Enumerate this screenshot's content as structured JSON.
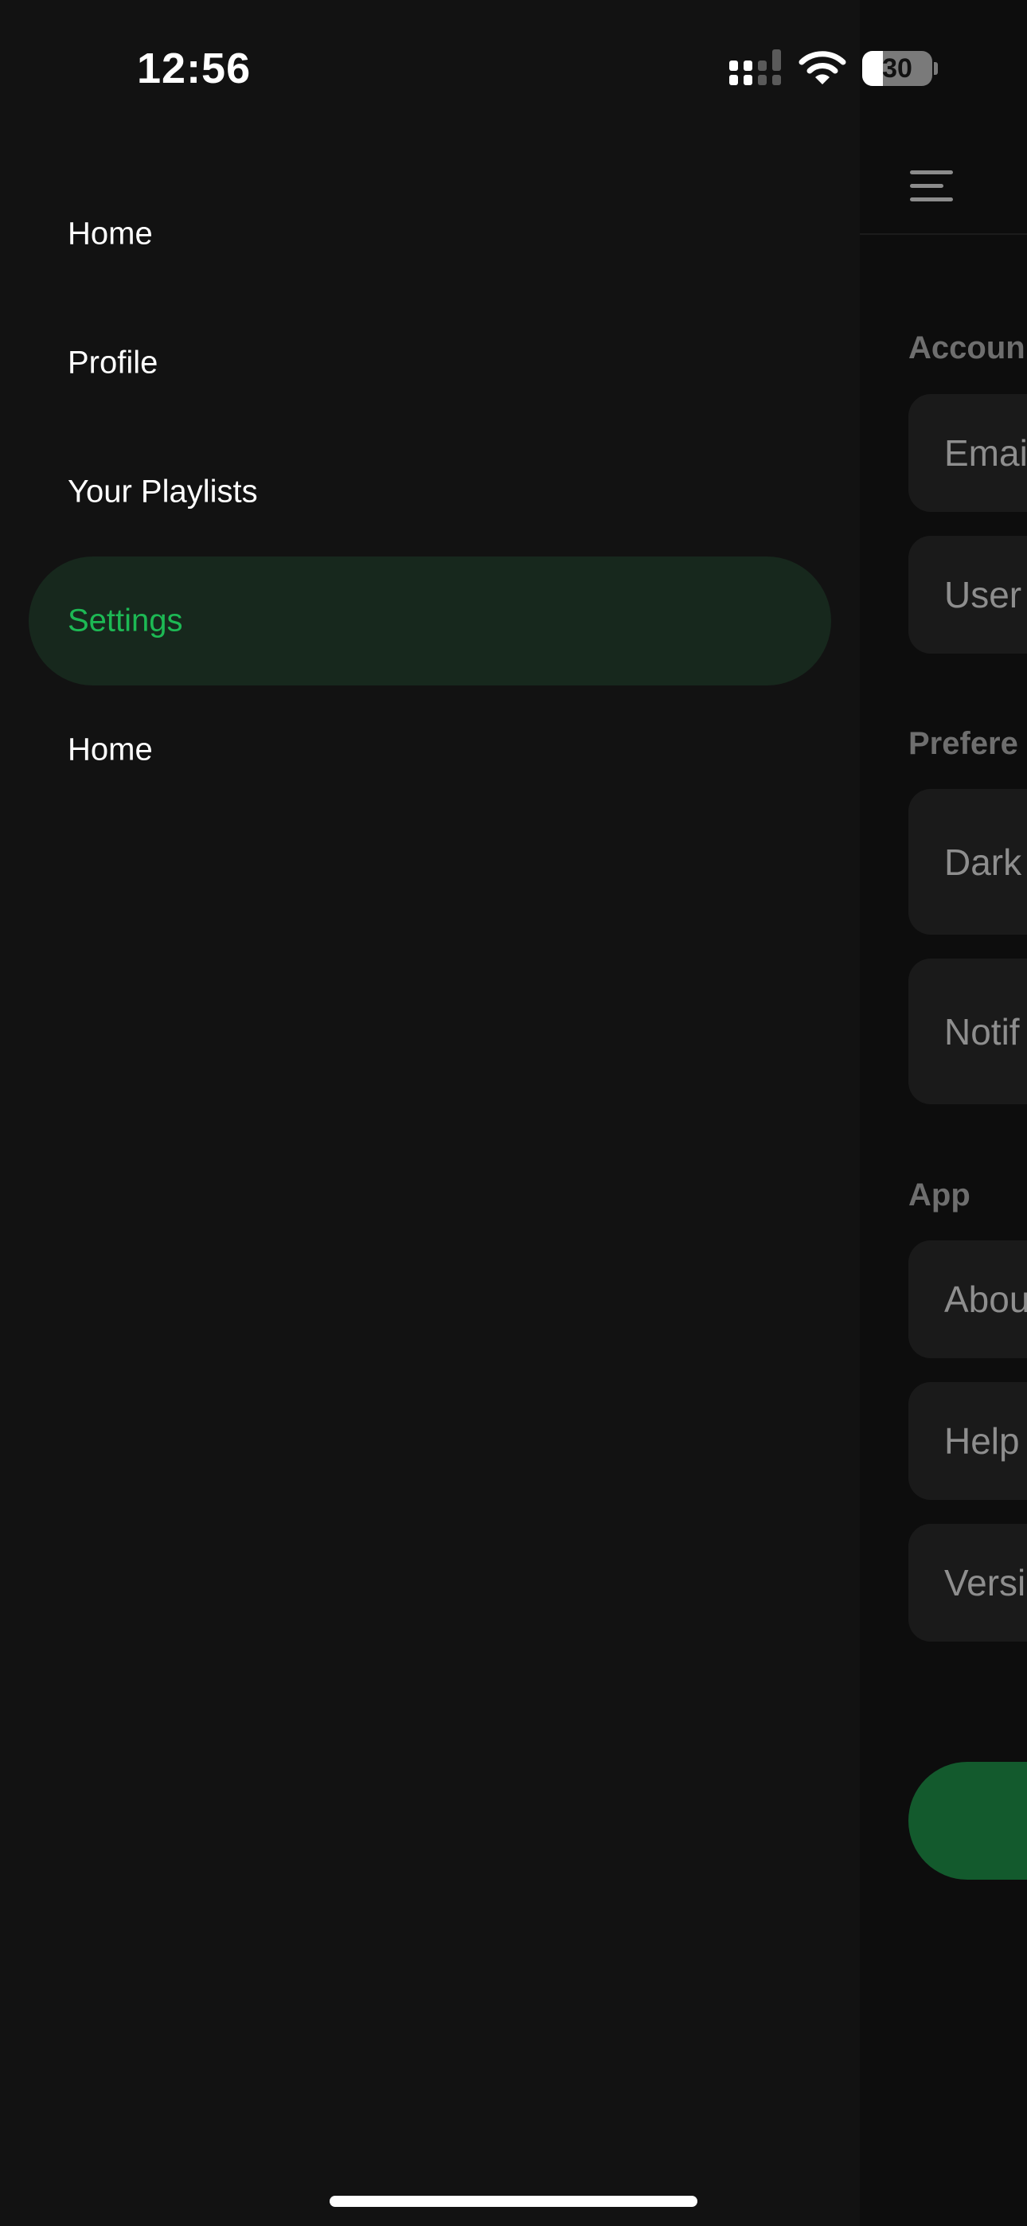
{
  "status_bar": {
    "time": "12:56",
    "battery_level": "30",
    "icons": [
      "signal-icon",
      "wifi-icon",
      "battery-icon"
    ]
  },
  "drawer": {
    "items": [
      {
        "label": "Home",
        "active": false
      },
      {
        "label": "Profile",
        "active": false
      },
      {
        "label": "Your Playlists",
        "active": false
      },
      {
        "label": "Settings",
        "active": true
      },
      {
        "label": "Home",
        "active": false
      }
    ]
  },
  "background_screen": {
    "menu_icon": "hamburger-menu-icon",
    "sections": [
      {
        "title": "Accoun",
        "rows": [
          "Emai",
          "User"
        ]
      },
      {
        "title": "Prefere",
        "rows": [
          "Dark",
          "Notif"
        ]
      },
      {
        "title": "App",
        "rows": [
          "Abou",
          "Help",
          "Versi"
        ]
      }
    ]
  },
  "colors": {
    "accent": "#1db954",
    "drawer_background": "#121212",
    "active_item_background": "#17281d",
    "primary_button": "#135a2d"
  }
}
